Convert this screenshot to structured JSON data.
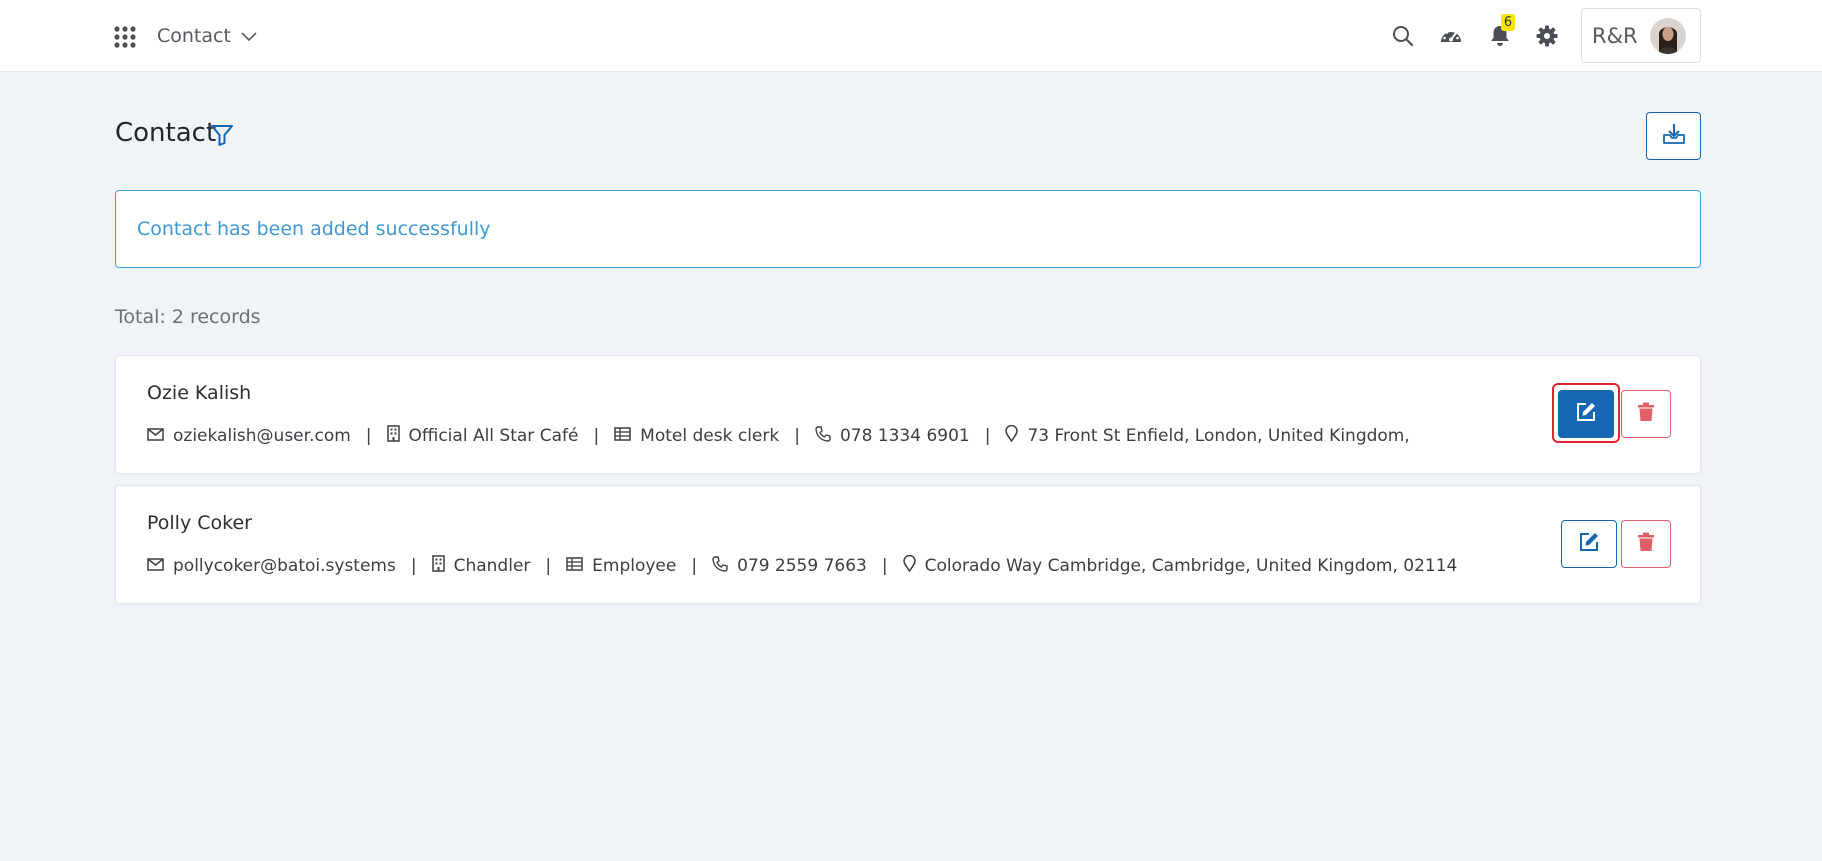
{
  "header": {
    "module_label": "Contact",
    "notification_count": "6",
    "user_initials": "R&R"
  },
  "page": {
    "title": "Contact",
    "alert_message": "Contact has been added successfully",
    "total_label": "Total: 2 records"
  },
  "contacts": [
    {
      "name": "Ozie Kalish",
      "email": "oziekalish@user.com",
      "company": "Official All Star Café",
      "job_title": "Motel desk clerk",
      "phone": "078 1334 6901",
      "address": "73 Front St Enfield, London, United Kingdom,"
    },
    {
      "name": "Polly Coker",
      "email": "pollycoker@batoi.systems",
      "company": "Chandler",
      "job_title": "Employee",
      "phone": "079 2559 7663",
      "address": "Colorado Way Cambridge, Cambridge, United Kingdom, 02114"
    }
  ],
  "colors": {
    "primary": "#1667b2",
    "danger": "#e0606a",
    "alert_text": "#3d9ad6",
    "badge": "#f7e600",
    "background": "#f0f3f8"
  }
}
